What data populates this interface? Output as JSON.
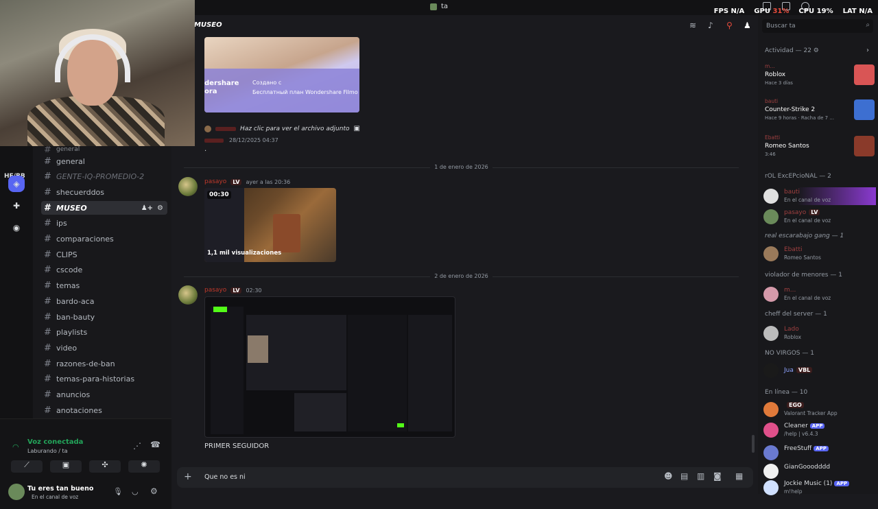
{
  "topbar": {
    "center_label": "ta",
    "fps_label": "FPS",
    "fps_val": "N/A",
    "gpu_label": "GPU",
    "gpu_val": "31%",
    "cpu_label": "CPU",
    "cpu_val": "19%",
    "lat_label": "LAT",
    "lat_val": "N/A"
  },
  "rail": {
    "label": "HE/BB"
  },
  "channels": [
    {
      "name": "general",
      "style": "normal",
      "top": 0
    },
    {
      "name": "general",
      "style": "normal"
    },
    {
      "name": "GENTE-IQ-PROMEDIO-2",
      "style": "gray"
    },
    {
      "name": "shecuerddos",
      "style": "normal"
    },
    {
      "name": "MUSEO",
      "style": "active"
    },
    {
      "name": "ips",
      "style": "normal"
    },
    {
      "name": "comparaciones",
      "style": "normal"
    },
    {
      "name": "CLIPS",
      "style": "normal"
    },
    {
      "name": "cscode",
      "style": "normal"
    },
    {
      "name": "temas",
      "style": "normal"
    },
    {
      "name": "bardo-aca",
      "style": "normal"
    },
    {
      "name": "ban-bauty",
      "style": "normal"
    },
    {
      "name": "playlists",
      "style": "normal"
    },
    {
      "name": "video",
      "style": "normal"
    },
    {
      "name": "razones-de-ban",
      "style": "normal"
    },
    {
      "name": "temas-para-historias",
      "style": "normal"
    },
    {
      "name": "anuncios",
      "style": "normal"
    },
    {
      "name": "anotaciones",
      "style": "normal"
    }
  ],
  "voice": {
    "status": "Voz conectada",
    "sub": "Laburando / ta"
  },
  "user": {
    "name": "Tu eres tan bueno",
    "status": "En el canal de voz"
  },
  "header": {
    "channel": "MUSEO"
  },
  "chat": {
    "attach_text": "Haz clic para ver el archivo adjunto",
    "msg0_ts": "28/12/2025 04:37",
    "msg0_body": ".",
    "wondershare_line1": "dershare",
    "wondershare_line2": "ora",
    "wondershare_ru1": "Создано с",
    "wondershare_ru2": "Бесплатный план Wondershare Filmo",
    "date1": "1 de enero de 2026",
    "msg1_user": "pasayo",
    "msg1_badge": "LV",
    "msg1_ts": "ayer a las 20:36",
    "video_duration": "00:30",
    "video_views": "1,1 mil visualizaciones",
    "date2": "2 de enero de 2026",
    "msg2_user": "pasayo",
    "msg2_badge": "LV",
    "msg2_ts": "02:30",
    "msg2_text": "PRIMER SEGUIDOR",
    "input_value": "Que no es ni"
  },
  "right": {
    "search_placeholder": "Buscar ta",
    "activity_header": "Actividad — 22",
    "activities": [
      {
        "user": "m...",
        "game": "Roblox",
        "meta": "Hace 3 días"
      },
      {
        "user": "bauti",
        "game": "Counter-Strike 2",
        "meta": "Hace 9 horas · Racha de 7 ..."
      },
      {
        "user": "Ebatti",
        "game": "Romeo Santos",
        "meta": "3:46"
      }
    ],
    "sections": [
      {
        "title": "rOL ExcEPcioNAL — 2",
        "members": [
          {
            "name": "bauti",
            "status": "En el canal de voz"
          },
          {
            "name": "pasayo",
            "badge": "LV",
            "status": "En el canal de voz"
          }
        ]
      },
      {
        "title": "real escarabajo gang — 1",
        "members": [
          {
            "name": "Ebatti",
            "status": "Romeo Santos"
          }
        ]
      },
      {
        "title": "violador de menores — 1",
        "members": [
          {
            "name": "m...",
            "status": "En el canal de voz"
          }
        ]
      },
      {
        "title": "cheff del server — 1",
        "members": [
          {
            "name": "Lado",
            "status": "Roblox"
          }
        ]
      },
      {
        "title": "NO VIRGOS — 1",
        "members": [
          {
            "name": "Jua",
            "badge": "VBL",
            "status": ""
          }
        ]
      },
      {
        "title": "En línea — 10",
        "members": [
          {
            "name": "",
            "badge": "EGO",
            "status": "Valorant Tracker App"
          },
          {
            "name": "Cleaner",
            "app": "APP",
            "status": "/help | v6.4.3"
          },
          {
            "name": "FreeStuff",
            "app": "APP",
            "status": ""
          },
          {
            "name": "GianGooodddd",
            "status": ""
          },
          {
            "name": "Jockie Music (1)",
            "app": "APP",
            "status": "m!help"
          }
        ]
      }
    ]
  }
}
